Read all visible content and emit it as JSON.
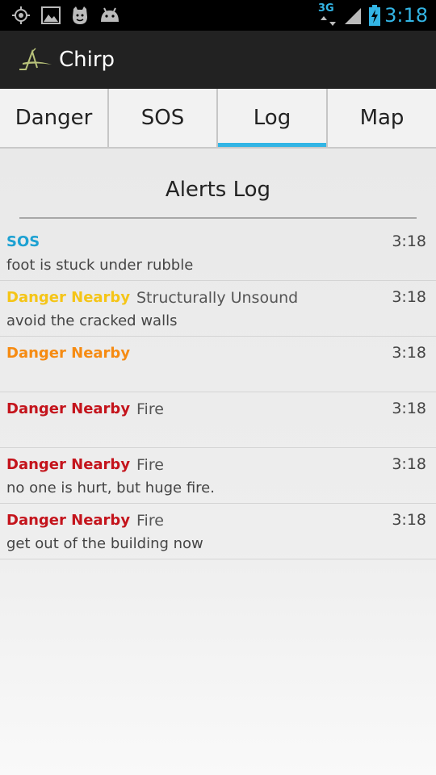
{
  "status_bar": {
    "time": "3:18",
    "network_label": "3G",
    "icons": [
      "gps-icon",
      "gallery-icon",
      "face-icon",
      "android-icon",
      "network-3g-icon",
      "signal-icon",
      "battery-charging-icon"
    ],
    "accent": "#33b5e5"
  },
  "app": {
    "title": "Chirp",
    "logo_icon": "chirp-logo-icon"
  },
  "tabs": [
    {
      "label": "Danger",
      "selected": false
    },
    {
      "label": "SOS",
      "selected": false
    },
    {
      "label": "Log",
      "selected": true
    },
    {
      "label": "Map",
      "selected": false
    }
  ],
  "log": {
    "title": "Alerts Log",
    "alerts": [
      {
        "type": "SOS",
        "category": "",
        "time": "3:18",
        "message": "foot is stuck under rubble",
        "color": "#1da1d2"
      },
      {
        "type": "Danger Nearby",
        "category": "Structurally Unsound",
        "time": "3:18",
        "message": "avoid the cracked walls",
        "color": "#f5c518"
      },
      {
        "type": "Danger Nearby",
        "category": "",
        "time": "3:18",
        "message": "",
        "color": "#f68b12"
      },
      {
        "type": "Danger Nearby",
        "category": "Fire",
        "time": "3:18",
        "message": "",
        "color": "#c4141c"
      },
      {
        "type": "Danger Nearby",
        "category": "Fire",
        "time": "3:18",
        "message": "no one is hurt, but huge fire.",
        "color": "#c4141c"
      },
      {
        "type": "Danger Nearby",
        "category": "Fire",
        "time": "3:18",
        "message": "get out of the building now",
        "color": "#c4141c"
      }
    ]
  }
}
